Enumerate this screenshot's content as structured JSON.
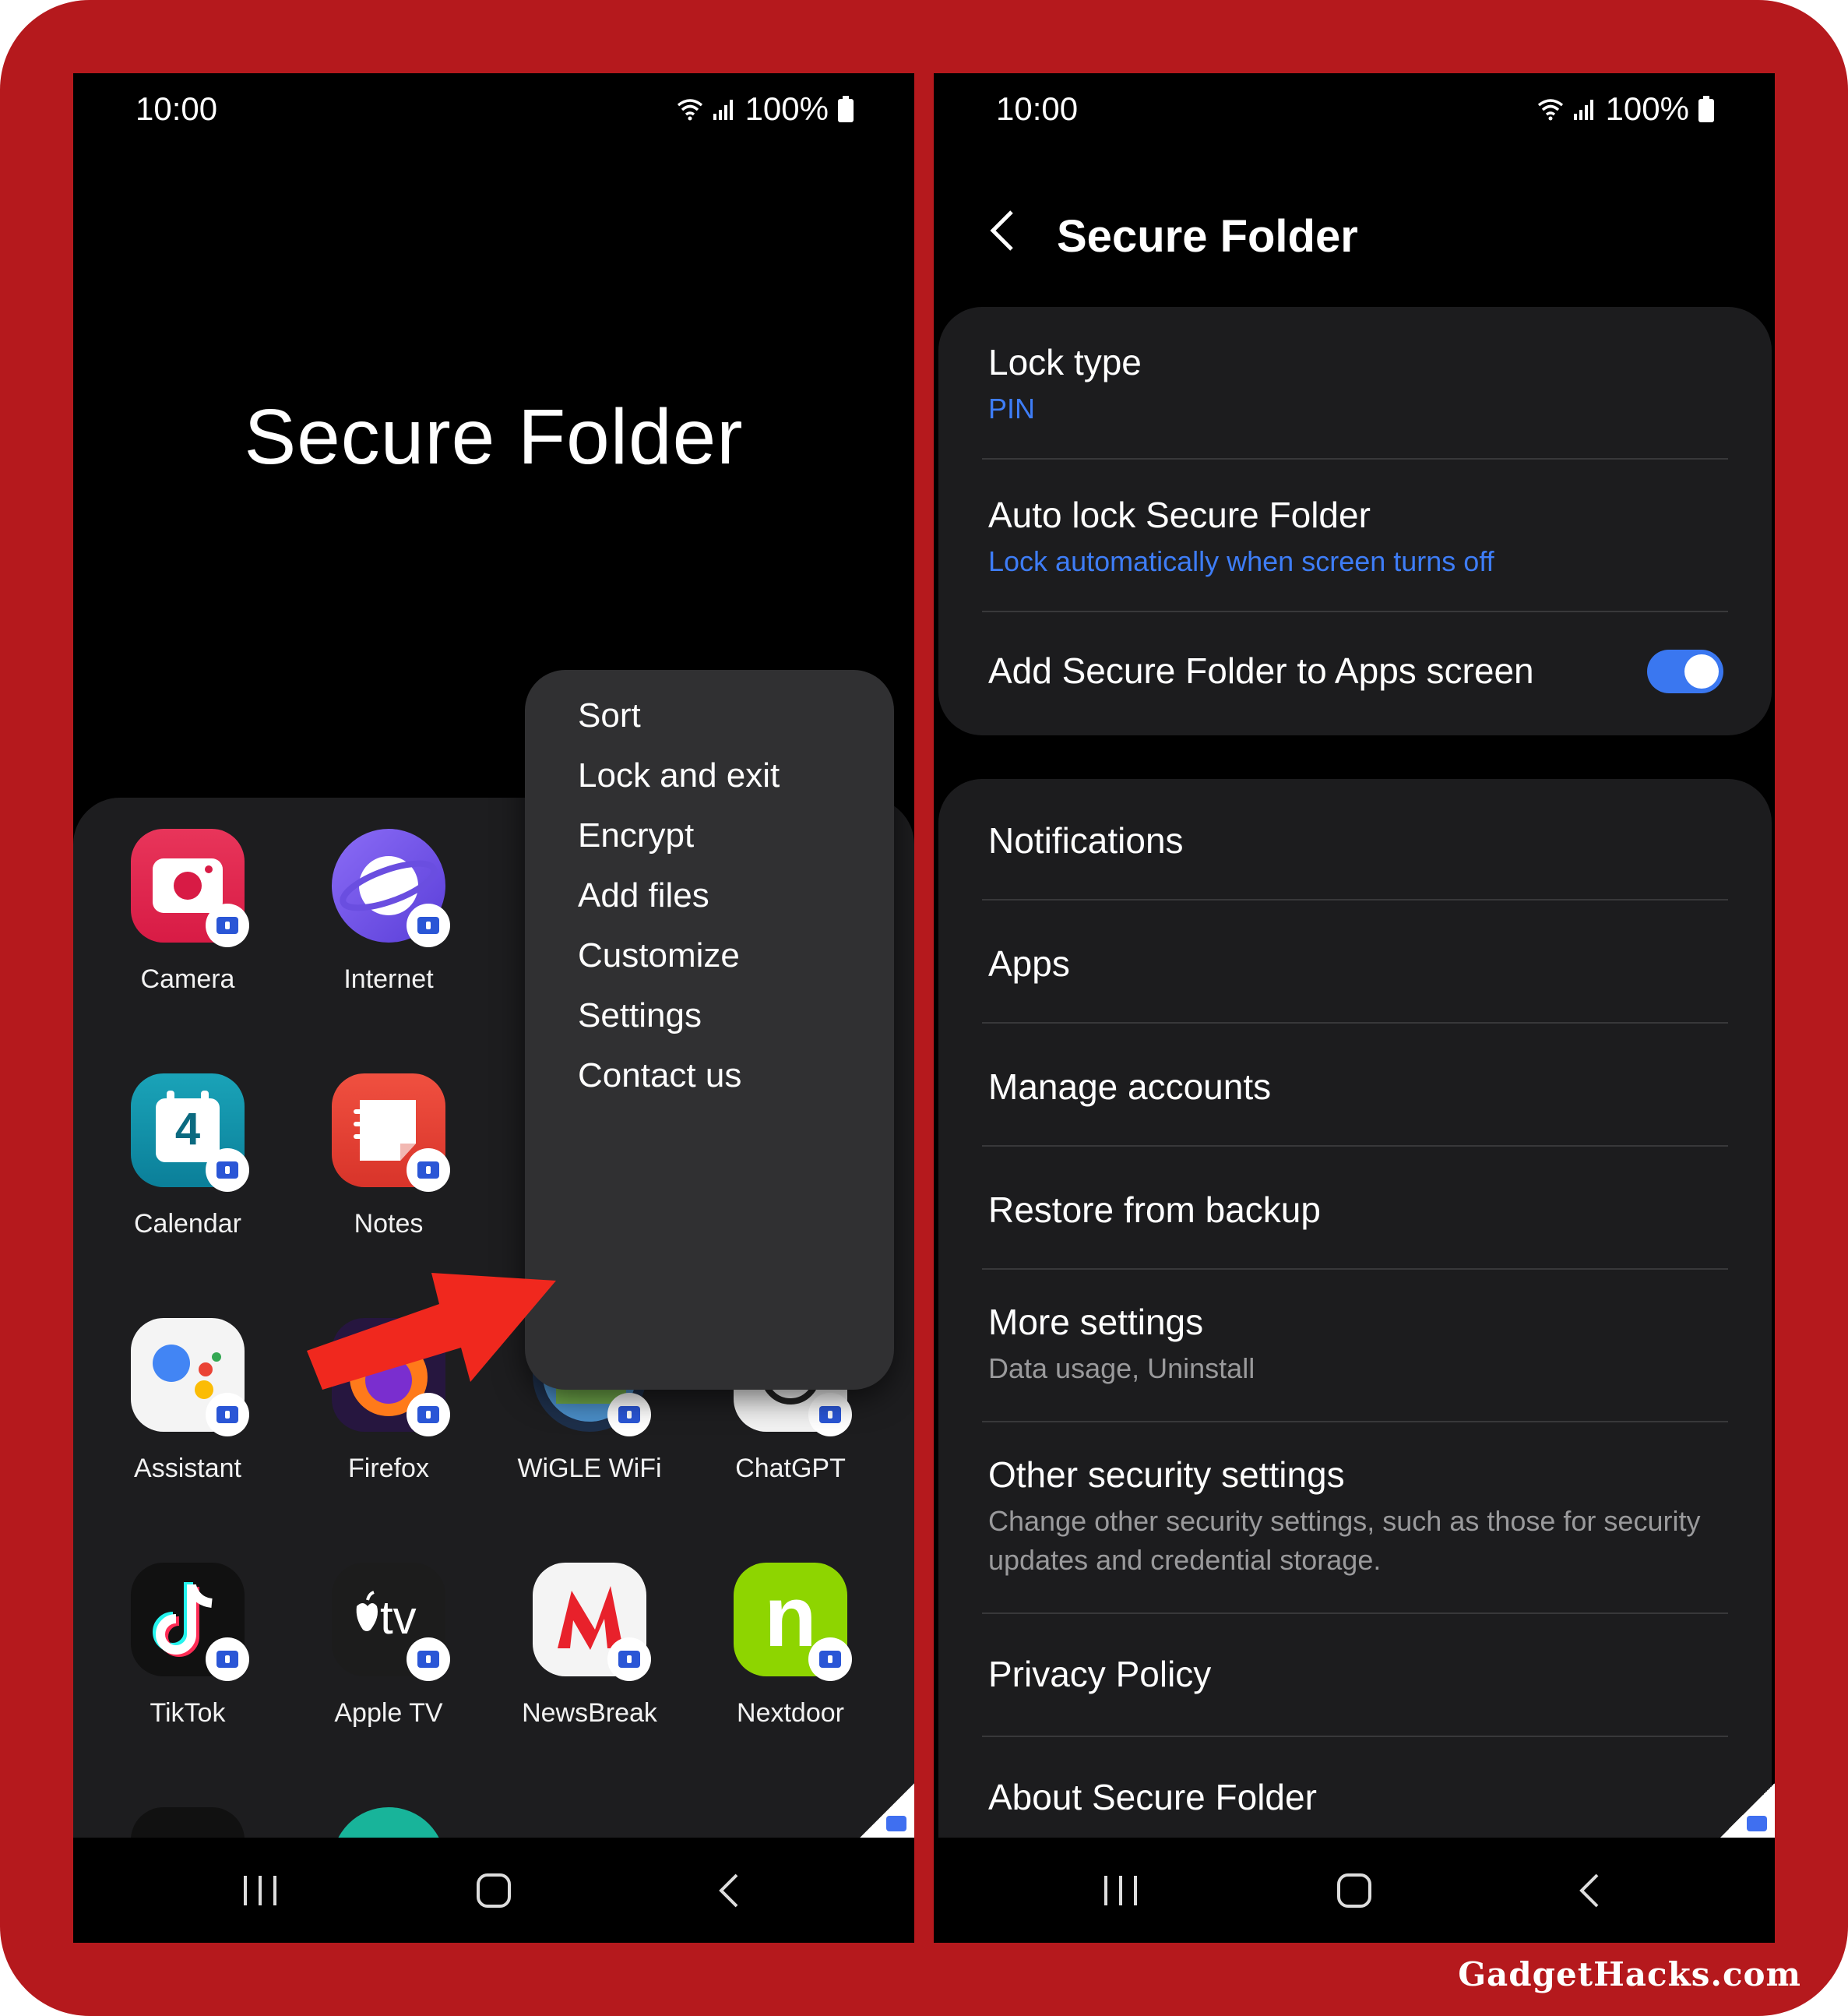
{
  "status_bar": {
    "time": "10:00",
    "battery": "100%"
  },
  "left": {
    "title": "Secure Folder",
    "apps": [
      {
        "label": "Camera",
        "icon": "camera-icon"
      },
      {
        "label": "Internet",
        "icon": "internet-icon"
      },
      {
        "label": "Calendar",
        "icon": "calendar-icon",
        "glyph": "4"
      },
      {
        "label": "Notes",
        "icon": "notes-icon"
      },
      {
        "label": "Assistant",
        "icon": "assistant-icon"
      },
      {
        "label": "Firefox",
        "icon": "firefox-icon"
      },
      {
        "label": "WiGLE WiFi",
        "icon": "wigle-icon"
      },
      {
        "label": "ChatGPT",
        "icon": "chatgpt-icon"
      },
      {
        "label": "TikTok",
        "icon": "tiktok-icon"
      },
      {
        "label": "Apple TV",
        "icon": "appletv-icon",
        "glyph": "tv"
      },
      {
        "label": "NewsBreak",
        "icon": "newsbreak-icon"
      },
      {
        "label": "Nextdoor",
        "icon": "nextdoor-icon",
        "glyph": "n"
      }
    ],
    "menu": [
      "Sort",
      "Lock and exit",
      "Encrypt",
      "Add files",
      "Customize",
      "Settings",
      "Contact us"
    ]
  },
  "right": {
    "title": "Secure Folder",
    "card1": {
      "lock_type": {
        "title": "Lock type",
        "subtitle": "PIN"
      },
      "auto_lock": {
        "title": "Auto lock Secure Folder",
        "subtitle": "Lock automatically when screen turns off"
      },
      "add_to_apps": {
        "title": "Add Secure Folder to Apps screen",
        "enabled": true
      }
    },
    "card2": {
      "notifications": "Notifications",
      "apps": "Apps",
      "manage_accounts": "Manage accounts",
      "restore": "Restore from backup",
      "more_settings": {
        "title": "More settings",
        "subtitle": "Data usage, Uninstall"
      },
      "other_security": {
        "title": "Other security settings",
        "subtitle": "Change other security settings, such as those for security updates and credential storage."
      },
      "privacy_policy": "Privacy Policy",
      "about": "About Secure Folder"
    }
  },
  "watermark": "GadgetHacks.com",
  "colors": {
    "frame": "#b5191d",
    "accent": "#3e7df7",
    "arrow": "#f0281e"
  }
}
